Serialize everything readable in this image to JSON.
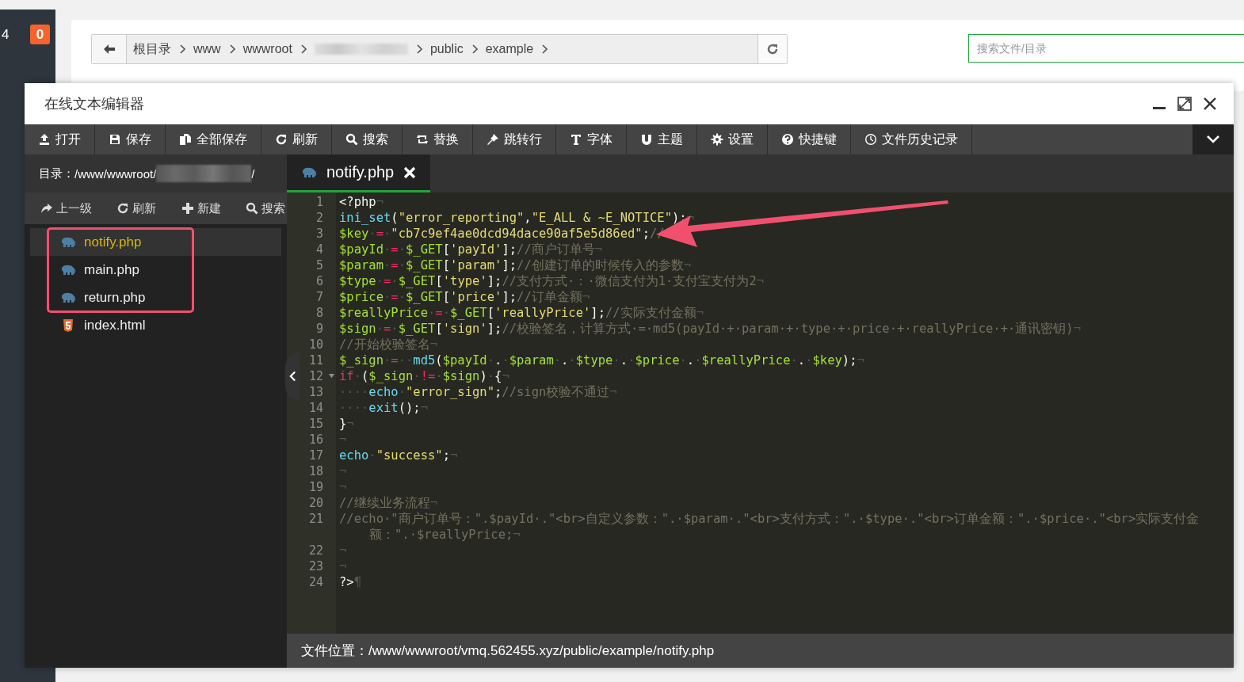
{
  "side_strip": {
    "number": "4",
    "badge": "0"
  },
  "breadcrumb": {
    "items": [
      {
        "kind": "text",
        "label": "根目录"
      },
      {
        "kind": "text",
        "label": "www"
      },
      {
        "kind": "text",
        "label": "wwwroot"
      },
      {
        "kind": "redacted"
      },
      {
        "kind": "text",
        "label": "public"
      },
      {
        "kind": "text",
        "label": "example"
      }
    ],
    "search": {
      "placeholder": "搜索文件/目录"
    }
  },
  "editor": {
    "title": "在线文本编辑器",
    "toolbar": [
      "打开",
      "保存",
      "全部保存",
      "刷新",
      "搜索",
      "替换",
      "跳转行",
      "字体",
      "主题",
      "设置",
      "快捷键",
      "文件历史记录"
    ],
    "directory": {
      "label": "目录：",
      "path": "/www/wwwroot/",
      "path_end": "/"
    },
    "sidebar_actions": [
      "上一级",
      "刷新",
      "新建",
      "搜索"
    ],
    "files": [
      {
        "name": "notify.php",
        "kind": "php",
        "selected": true
      },
      {
        "name": "main.php",
        "kind": "php",
        "selected": false
      },
      {
        "name": "return.php",
        "kind": "php",
        "selected": false
      },
      {
        "name": "index.html",
        "kind": "html",
        "selected": false
      }
    ],
    "tabs": [
      {
        "label": "notify.php",
        "selected": true
      }
    ],
    "lines": [
      {
        "number": "1",
        "fold": false,
        "tokens": [
          {
            "kind": "plain",
            "text": "<?php"
          },
          {
            "kind": "whitespace",
            "text": "¬"
          }
        ]
      },
      {
        "number": "2",
        "fold": false,
        "tokens": [
          {
            "kind": "function",
            "text": "ini_set"
          },
          {
            "kind": "plain",
            "text": "("
          },
          {
            "kind": "string",
            "text": "\"error_reporting\""
          },
          {
            "kind": "plain",
            "text": ","
          },
          {
            "kind": "string",
            "text": "\"E_ALL & ~E_NOTICE\""
          },
          {
            "kind": "plain",
            "text": ");"
          },
          {
            "kind": "whitespace",
            "text": "¬"
          }
        ]
      },
      {
        "number": "3",
        "fold": false,
        "tokens": [
          {
            "kind": "variable",
            "text": "$key"
          },
          {
            "kind": "whitespace",
            "text": "·"
          },
          {
            "kind": "operator",
            "text": "="
          },
          {
            "kind": "whitespace",
            "text": "·"
          },
          {
            "kind": "string",
            "text": "\"cb7c9ef4ae0dcd94dace90af5e5d86ed\""
          },
          {
            "kind": "plain",
            "text": ";"
          },
          {
            "kind": "comment",
            "text": "//"
          }
        ]
      },
      {
        "number": "4",
        "fold": false,
        "tokens": [
          {
            "kind": "variable",
            "text": "$payId"
          },
          {
            "kind": "whitespace",
            "text": "·"
          },
          {
            "kind": "operator",
            "text": "="
          },
          {
            "kind": "whitespace",
            "text": "·"
          },
          {
            "kind": "variable",
            "text": "$_GET"
          },
          {
            "kind": "plain",
            "text": "["
          },
          {
            "kind": "string",
            "text": "'payId'"
          },
          {
            "kind": "plain",
            "text": "];"
          },
          {
            "kind": "comment",
            "text": "//商户订单号"
          },
          {
            "kind": "whitespace",
            "text": "¬"
          }
        ]
      },
      {
        "number": "5",
        "fold": false,
        "tokens": [
          {
            "kind": "variable",
            "text": "$param"
          },
          {
            "kind": "whitespace",
            "text": "·"
          },
          {
            "kind": "operator",
            "text": "="
          },
          {
            "kind": "whitespace",
            "text": "·"
          },
          {
            "kind": "variable",
            "text": "$_GET"
          },
          {
            "kind": "plain",
            "text": "["
          },
          {
            "kind": "string",
            "text": "'param'"
          },
          {
            "kind": "plain",
            "text": "];"
          },
          {
            "kind": "comment",
            "text": "//创建订单的时候传入的参数"
          },
          {
            "kind": "whitespace",
            "text": "¬"
          }
        ]
      },
      {
        "number": "6",
        "fold": false,
        "tokens": [
          {
            "kind": "variable",
            "text": "$type"
          },
          {
            "kind": "whitespace",
            "text": "·"
          },
          {
            "kind": "operator",
            "text": "="
          },
          {
            "kind": "whitespace",
            "text": "·"
          },
          {
            "kind": "variable",
            "text": "$_GET"
          },
          {
            "kind": "plain",
            "text": "["
          },
          {
            "kind": "string",
            "text": "'type'"
          },
          {
            "kind": "plain",
            "text": "];"
          },
          {
            "kind": "comment",
            "text": "//支付方式·：·微信支付为1·支付宝支付为2"
          },
          {
            "kind": "whitespace",
            "text": "¬"
          }
        ]
      },
      {
        "number": "7",
        "fold": false,
        "tokens": [
          {
            "kind": "variable",
            "text": "$price"
          },
          {
            "kind": "whitespace",
            "text": "·"
          },
          {
            "kind": "operator",
            "text": "="
          },
          {
            "kind": "whitespace",
            "text": "·"
          },
          {
            "kind": "variable",
            "text": "$_GET"
          },
          {
            "kind": "plain",
            "text": "["
          },
          {
            "kind": "string",
            "text": "'price'"
          },
          {
            "kind": "plain",
            "text": "];"
          },
          {
            "kind": "comment",
            "text": "//订单金额"
          },
          {
            "kind": "whitespace",
            "text": "¬"
          }
        ]
      },
      {
        "number": "8",
        "fold": false,
        "tokens": [
          {
            "kind": "variable",
            "text": "$reallyPrice"
          },
          {
            "kind": "whitespace",
            "text": "·"
          },
          {
            "kind": "operator",
            "text": "="
          },
          {
            "kind": "whitespace",
            "text": "·"
          },
          {
            "kind": "variable",
            "text": "$_GET"
          },
          {
            "kind": "plain",
            "text": "["
          },
          {
            "kind": "string",
            "text": "'reallyPrice'"
          },
          {
            "kind": "plain",
            "text": "];"
          },
          {
            "kind": "comment",
            "text": "//实际支付金额"
          },
          {
            "kind": "whitespace",
            "text": "¬"
          }
        ]
      },
      {
        "number": "9",
        "fold": false,
        "tokens": [
          {
            "kind": "variable",
            "text": "$sign"
          },
          {
            "kind": "whitespace",
            "text": "·"
          },
          {
            "kind": "operator",
            "text": "="
          },
          {
            "kind": "whitespace",
            "text": "·"
          },
          {
            "kind": "variable",
            "text": "$_GET"
          },
          {
            "kind": "plain",
            "text": "["
          },
          {
            "kind": "string",
            "text": "'sign'"
          },
          {
            "kind": "plain",
            "text": "];"
          },
          {
            "kind": "comment",
            "text": "//校验签名，计算方式·=·md5(payId·+·param·+·type·+·price·+·reallyPrice·+·通讯密钥)"
          },
          {
            "kind": "whitespace",
            "text": "¬"
          }
        ]
      },
      {
        "number": "10",
        "fold": false,
        "tokens": [
          {
            "kind": "comment",
            "text": "//开始校验签名"
          },
          {
            "kind": "whitespace",
            "text": "¬"
          }
        ]
      },
      {
        "number": "11",
        "fold": false,
        "tokens": [
          {
            "kind": "variable",
            "text": "$_sign"
          },
          {
            "kind": "whitespace",
            "text": "·"
          },
          {
            "kind": "operator",
            "text": "="
          },
          {
            "kind": "whitespace",
            "text": "··"
          },
          {
            "kind": "function",
            "text": "md5"
          },
          {
            "kind": "plain",
            "text": "("
          },
          {
            "kind": "variable",
            "text": "$payId"
          },
          {
            "kind": "whitespace",
            "text": "·"
          },
          {
            "kind": "plain",
            "text": "."
          },
          {
            "kind": "whitespace",
            "text": "·"
          },
          {
            "kind": "variable",
            "text": "$param"
          },
          {
            "kind": "whitespace",
            "text": "·"
          },
          {
            "kind": "plain",
            "text": "."
          },
          {
            "kind": "whitespace",
            "text": "·"
          },
          {
            "kind": "variable",
            "text": "$type"
          },
          {
            "kind": "whitespace",
            "text": "·"
          },
          {
            "kind": "plain",
            "text": "."
          },
          {
            "kind": "whitespace",
            "text": "·"
          },
          {
            "kind": "variable",
            "text": "$price"
          },
          {
            "kind": "whitespace",
            "text": "·"
          },
          {
            "kind": "plain",
            "text": "."
          },
          {
            "kind": "whitespace",
            "text": "·"
          },
          {
            "kind": "variable",
            "text": "$reallyPrice"
          },
          {
            "kind": "whitespace",
            "text": "·"
          },
          {
            "kind": "plain",
            "text": "."
          },
          {
            "kind": "whitespace",
            "text": "·"
          },
          {
            "kind": "variable",
            "text": "$key"
          },
          {
            "kind": "plain",
            "text": ");"
          },
          {
            "kind": "whitespace",
            "text": "¬"
          }
        ]
      },
      {
        "number": "12",
        "fold": true,
        "tokens": [
          {
            "kind": "keyword",
            "text": "if"
          },
          {
            "kind": "whitespace",
            "text": "·"
          },
          {
            "kind": "plain",
            "text": "("
          },
          {
            "kind": "variable",
            "text": "$_sign"
          },
          {
            "kind": "whitespace",
            "text": "·"
          },
          {
            "kind": "operator",
            "text": "!="
          },
          {
            "kind": "whitespace",
            "text": "·"
          },
          {
            "kind": "variable",
            "text": "$sign"
          },
          {
            "kind": "plain",
            "text": ")"
          },
          {
            "kind": "whitespace",
            "text": "·"
          },
          {
            "kind": "plain",
            "text": "{"
          },
          {
            "kind": "whitespace",
            "text": "¬"
          }
        ]
      },
      {
        "number": "13",
        "fold": false,
        "tokens": [
          {
            "kind": "whitespace",
            "text": "····"
          },
          {
            "kind": "function",
            "text": "echo"
          },
          {
            "kind": "whitespace",
            "text": "·"
          },
          {
            "kind": "string",
            "text": "\"error_sign\""
          },
          {
            "kind": "plain",
            "text": ";"
          },
          {
            "kind": "comment",
            "text": "//sign校验不通过"
          },
          {
            "kind": "whitespace",
            "text": "¬"
          }
        ]
      },
      {
        "number": "14",
        "fold": false,
        "tokens": [
          {
            "kind": "whitespace",
            "text": "····"
          },
          {
            "kind": "function",
            "text": "exit"
          },
          {
            "kind": "plain",
            "text": "();"
          },
          {
            "kind": "whitespace",
            "text": "¬"
          }
        ]
      },
      {
        "number": "15",
        "fold": false,
        "tokens": [
          {
            "kind": "plain",
            "text": "}"
          },
          {
            "kind": "whitespace",
            "text": "¬"
          }
        ]
      },
      {
        "number": "16",
        "fold": false,
        "tokens": [
          {
            "kind": "whitespace",
            "text": "¬"
          }
        ]
      },
      {
        "number": "17",
        "fold": false,
        "tokens": [
          {
            "kind": "function",
            "text": "echo"
          },
          {
            "kind": "whitespace",
            "text": "·"
          },
          {
            "kind": "string",
            "text": "\"success\""
          },
          {
            "kind": "plain",
            "text": ";"
          },
          {
            "kind": "whitespace",
            "text": "¬"
          }
        ]
      },
      {
        "number": "18",
        "fold": false,
        "tokens": [
          {
            "kind": "whitespace",
            "text": "¬"
          }
        ]
      },
      {
        "number": "19",
        "fold": false,
        "tokens": [
          {
            "kind": "whitespace",
            "text": "¬"
          }
        ]
      },
      {
        "number": "20",
        "fold": false,
        "tokens": [
          {
            "kind": "comment",
            "text": "//继续业务流程"
          },
          {
            "kind": "whitespace",
            "text": "¬"
          }
        ]
      },
      {
        "number": "21",
        "fold": false,
        "tokens": [
          {
            "kind": "comment",
            "text": "//echo·\"商户订单号：\".$payId·.\"<br>自定义参数：\".·$param·.\"<br>支付方式：\".·$type·.\"<br>订单金额：\".·$price·.\"<br>实际支付金额：\".·$reallyPrice;"
          },
          {
            "kind": "whitespace",
            "text": "¬"
          }
        ]
      },
      {
        "number": "22",
        "fold": false,
        "tokens": [
          {
            "kind": "whitespace",
            "text": "¬"
          }
        ]
      },
      {
        "number": "23",
        "fold": false,
        "tokens": [
          {
            "kind": "whitespace",
            "text": "¬"
          }
        ]
      },
      {
        "number": "24",
        "fold": false,
        "tokens": [
          {
            "kind": "plain",
            "text": "?>"
          },
          {
            "kind": "whitespace",
            "text": "¶"
          }
        ]
      }
    ],
    "status": {
      "label": "文件位置：",
      "path": "/www/wwwroot/vmq.562455.xyz/public/example/notify.php"
    }
  }
}
